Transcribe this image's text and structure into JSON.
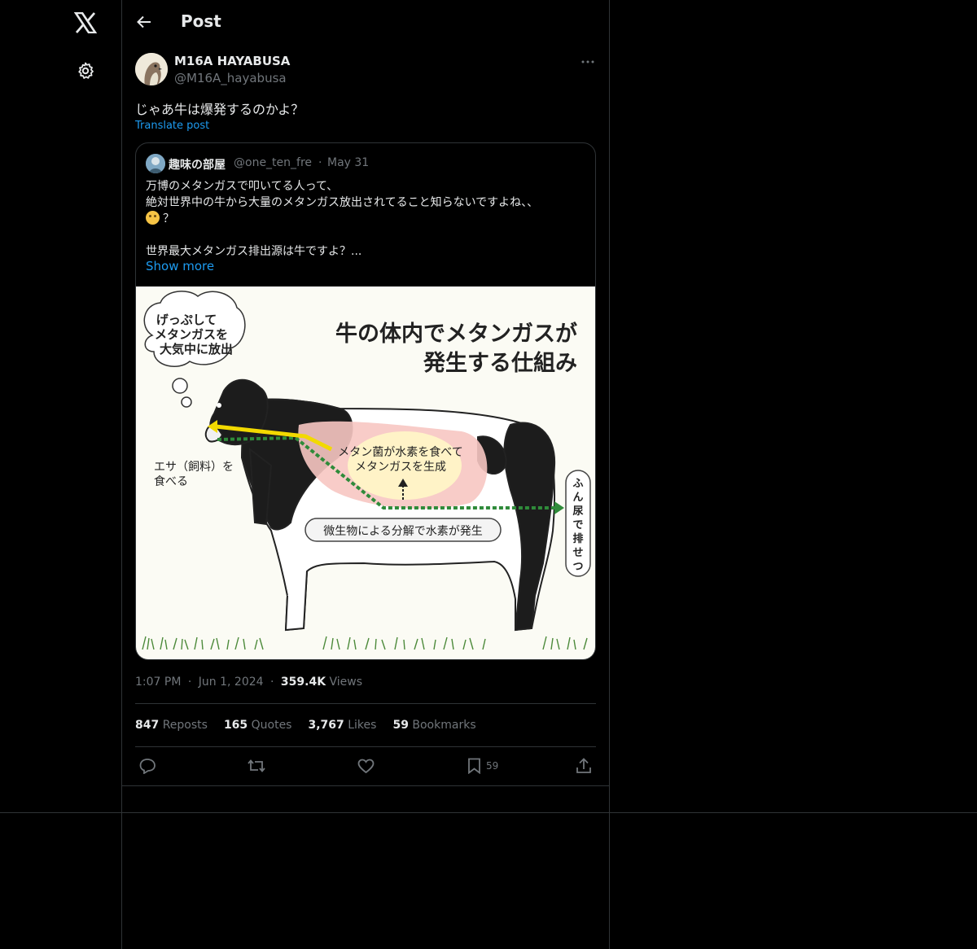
{
  "header": {
    "title": "Post"
  },
  "author": {
    "name": "M16A HAYABUSA",
    "handle": "@M16A_hayabusa"
  },
  "post": {
    "text": "じゃあ牛は爆発するのかよ？",
    "translate_label": "Translate post"
  },
  "quote": {
    "name": "趣味の部屋",
    "handle": "@one_ten_fre",
    "separator": "·",
    "date": "May 31",
    "line1": "万博のメタンガスで叩いてる人って、",
    "line2": "絶対世界中の牛から大量のメタンガス放出されてること知らないですよね、、",
    "line3": "？",
    "line4": "世界最大メタンガス排出源は牛ですよ？...",
    "show_more": "Show more",
    "image": {
      "thought_bubble": [
        "げっぷして",
        "メタンガスを",
        "大気中に放出"
      ],
      "title_line1": "牛の体内でメタンガスが",
      "title_line2": "発生する仕組み",
      "label_feed": [
        "エサ（飼料）を",
        "食べる"
      ],
      "label_bacteria": [
        "メタン菌が水素を食べて",
        "メタンガスを生成"
      ],
      "label_microbes": "微生物による分解で水素が発生",
      "label_excrete": [
        "ふ",
        "ん",
        "尿",
        "で",
        "排",
        "せ",
        "つ"
      ]
    }
  },
  "meta": {
    "time": "1:07 PM",
    "sep1": "·",
    "date": "Jun 1, 2024",
    "sep2": "·",
    "views_count": "359.4K",
    "views_label": "Views"
  },
  "stats": {
    "reposts_count": "847",
    "reposts_label": "Reposts",
    "quotes_count": "165",
    "quotes_label": "Quotes",
    "likes_count": "3,767",
    "likes_label": "Likes",
    "bookmarks_count": "59",
    "bookmarks_label": "Bookmarks"
  },
  "actions": {
    "bookmark_count": "59"
  },
  "icons": {
    "logo": "x-logo-icon",
    "settings": "gear-icon",
    "back": "back-arrow-icon",
    "more": "more-horizontal-icon",
    "reply": "reply-icon",
    "repost": "repost-icon",
    "like": "heart-icon",
    "bookmark": "bookmark-icon",
    "share": "share-icon"
  },
  "colors": {
    "background": "#000000",
    "border": "#2f3336",
    "text": "#e7e9ea",
    "secondary": "#71767b",
    "link": "#1d9bf0"
  }
}
